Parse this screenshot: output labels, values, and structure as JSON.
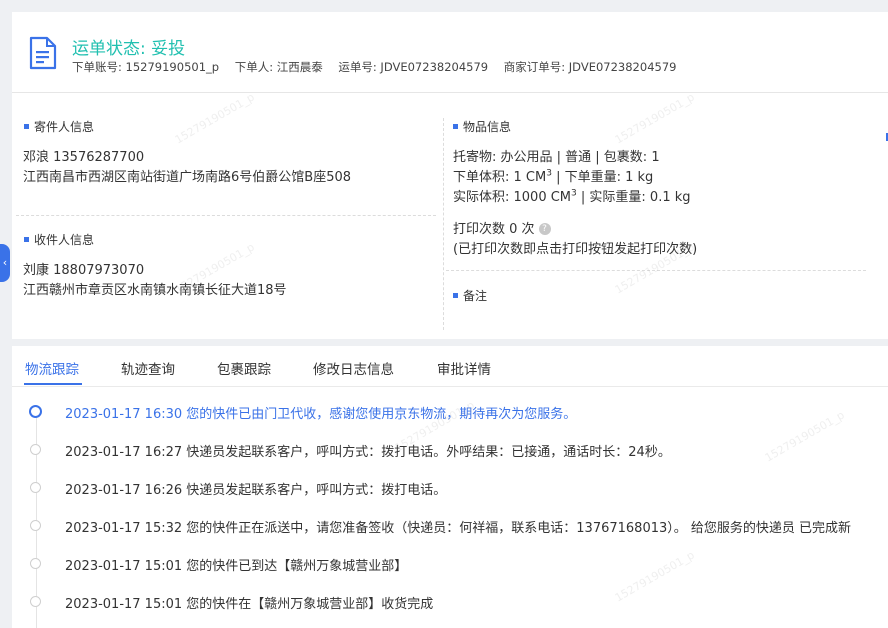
{
  "header": {
    "status": "运单状态: 妥投",
    "account": "下单账号: 15279190501_p",
    "orderer": "下单人: 江西晨泰",
    "waybill": "运单号: JDVE07238204579",
    "merchant_order": "商家订单号: JDVE07238204579"
  },
  "sender": {
    "title": "寄件人信息",
    "name_phone": "邓浪   13576287700",
    "address": "江西南昌市西湖区南站街道广场南路6号伯爵公馆B座508"
  },
  "receiver": {
    "title": "收件人信息",
    "name_phone": "刘康   18807973070",
    "address": "江西赣州市章贡区水南镇水南镇长征大道18号"
  },
  "goods": {
    "title": "物品信息",
    "line1": "托寄物:  办公用品 | 普通 | 包裹数:  1",
    "order_vol_label": "下单体积:    1 CM",
    "order_weight": " | 下单重量:   1 kg",
    "actual_vol_label": "实际体积:    1000 CM",
    "actual_weight": " | 实际重量:   0.1 kg",
    "sup": "3",
    "print_count": "打印次数   0 次",
    "print_hint": "(已打印次数即点击打印按钮发起打印次数)"
  },
  "remark": {
    "title": "备注"
  },
  "tabs": [
    "物流跟踪",
    "轨迹查询",
    "包裹跟踪",
    "修改日志信息",
    "审批详情"
  ],
  "timeline": [
    "2023-01-17 16:30 您的快件已由门卫代收，感谢您使用京东物流，期待再次为您服务。",
    "2023-01-17 16:27 快递员发起联系客户，呼叫方式：拨打电话。外呼结果：已接通，通话时长：24秒。",
    "2023-01-17 16:26 快递员发起联系客户，呼叫方式：拨打电话。",
    "2023-01-17 15:32 您的快件正在派送中，请您准备签收（快递员：何祥福，联系电话：13767168013）。 给您服务的快递员 已完成新",
    "2023-01-17 15:01 您的快件已到达【赣州万象城营业部】",
    "2023-01-17 15:01 您的快件在【赣州万象城营业部】收货完成"
  ],
  "watermark": "15279190501_p",
  "colors": {
    "accent": "#3a72e8",
    "status": "#21c0b0"
  }
}
